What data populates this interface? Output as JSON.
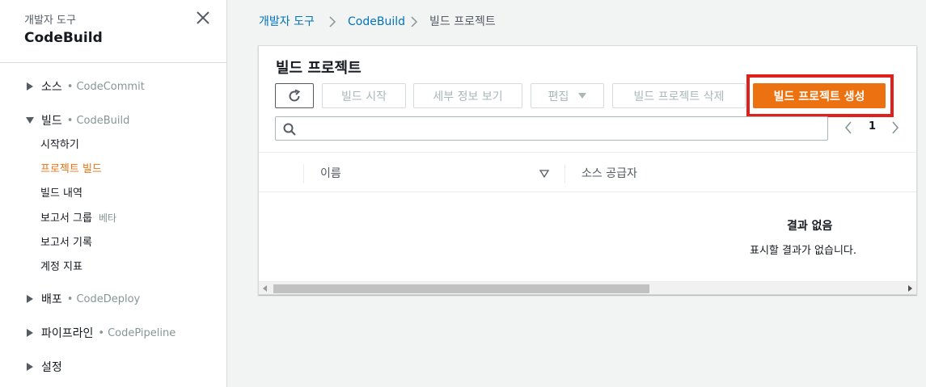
{
  "sidebar": {
    "subtitle": "개발자 도구",
    "title": "CodeBuild",
    "sections": [
      {
        "label": "소스",
        "service": "CodeCommit"
      },
      {
        "label": "빌드",
        "service": "CodeBuild"
      },
      {
        "label": "배포",
        "service": "CodeDeploy"
      },
      {
        "label": "파이프라인",
        "service": "CodePipeline"
      },
      {
        "label": "설정",
        "service": ""
      }
    ],
    "dot": "•",
    "build_items": [
      {
        "label": "시작하기"
      },
      {
        "label": "프로젝트 빌드"
      },
      {
        "label": "빌드 내역"
      },
      {
        "label": "보고서 그룹",
        "badge": "베타"
      },
      {
        "label": "보고서 기록"
      },
      {
        "label": "계정 지표"
      }
    ]
  },
  "breadcrumb": [
    "개발자 도구",
    "CodeBuild",
    "빌드 프로젝트"
  ],
  "panel": {
    "title": "빌드 프로젝트",
    "buttons": {
      "start": "빌드 시작",
      "details": "세부 정보 보기",
      "edit": "편집",
      "delete": "빌드 프로젝트 삭제",
      "create": "빌드 프로젝트 생성"
    },
    "search": {
      "value": "",
      "placeholder": ""
    },
    "pagination": {
      "current": "1"
    },
    "columns": [
      "이름",
      "소스 공급자"
    ],
    "empty": {
      "title": "결과 없음",
      "text": "표시할 결과가 없습니다."
    }
  },
  "colors": {
    "accent": "#ec7211",
    "link": "#0073bb",
    "highlight": "#e0211b"
  }
}
